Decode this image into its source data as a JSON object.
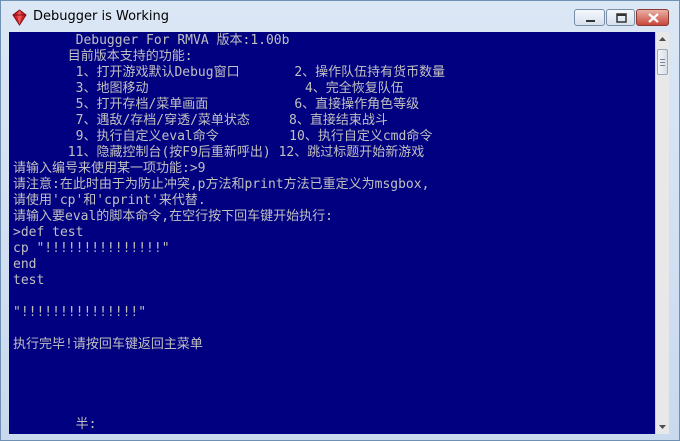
{
  "window": {
    "title": "Debugger is Working"
  },
  "console": {
    "lines": [
      "        Debugger For RMVA 版本:1.00b",
      "       目前版本支持的功能:",
      "        1、打开游戏默认Debug窗口       2、操作队伍持有货币数量",
      "        3、地图移动                    4、完全恢复队伍",
      "        5、打开存档/菜单画面           6、直接操作角色等级",
      "        7、遇敌/存档/穿透/菜单状态     8、直接结束战斗",
      "        9、执行自定义eval命令         10、执行自定义cmd命令",
      "       11、隐藏控制台(按F9后重新呼出) 12、跳过标题开始新游戏",
      "请输入编号来使用某一项功能:>9",
      "请注意:在此时由于为防止冲突,p方法和print方法已重定义为msgbox,",
      "请使用'cp'和'cprint'来代替.",
      "请输入要eval的脚本命令,在空行按下回车键开始执行:",
      ">def test",
      "cp \"!!!!!!!!!!!!!!!\"",
      "end",
      "test",
      "",
      "\"!!!!!!!!!!!!!!!\"",
      "",
      "执行完毕!请按回车键返回主菜单",
      "",
      "",
      "",
      "",
      "        半:"
    ]
  },
  "colors": {
    "console_bg": "#000080",
    "console_text": "#c0c0c0"
  },
  "icons": {
    "app": "ruby-gem-icon",
    "minimize": "minimize-icon",
    "maximize": "maximize-icon",
    "close": "close-icon"
  }
}
